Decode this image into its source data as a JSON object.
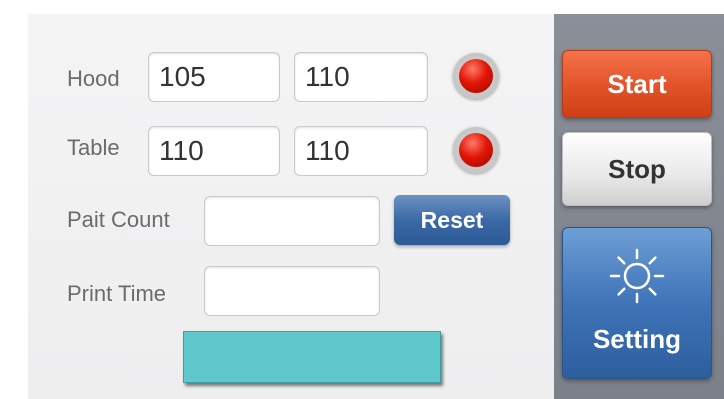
{
  "temperatures": {
    "hood": {
      "label": "Hood",
      "value_a": "105",
      "value_b": "110"
    },
    "table": {
      "label": "Table",
      "value_a": "110",
      "value_b": "110"
    }
  },
  "pait_count": {
    "label": "Pait Count",
    "value": ""
  },
  "print_time": {
    "label": "Print Time",
    "value": ""
  },
  "reset_label": "Reset",
  "side": {
    "start_label": "Start",
    "stop_label": "Stop",
    "setting_label": "Setting",
    "setting_icon": "sun-icon"
  },
  "colors": {
    "indicator": "#e11606",
    "start": "#e4552b",
    "setting": "#3f74b8",
    "status_bar": "#5fc8cc"
  }
}
